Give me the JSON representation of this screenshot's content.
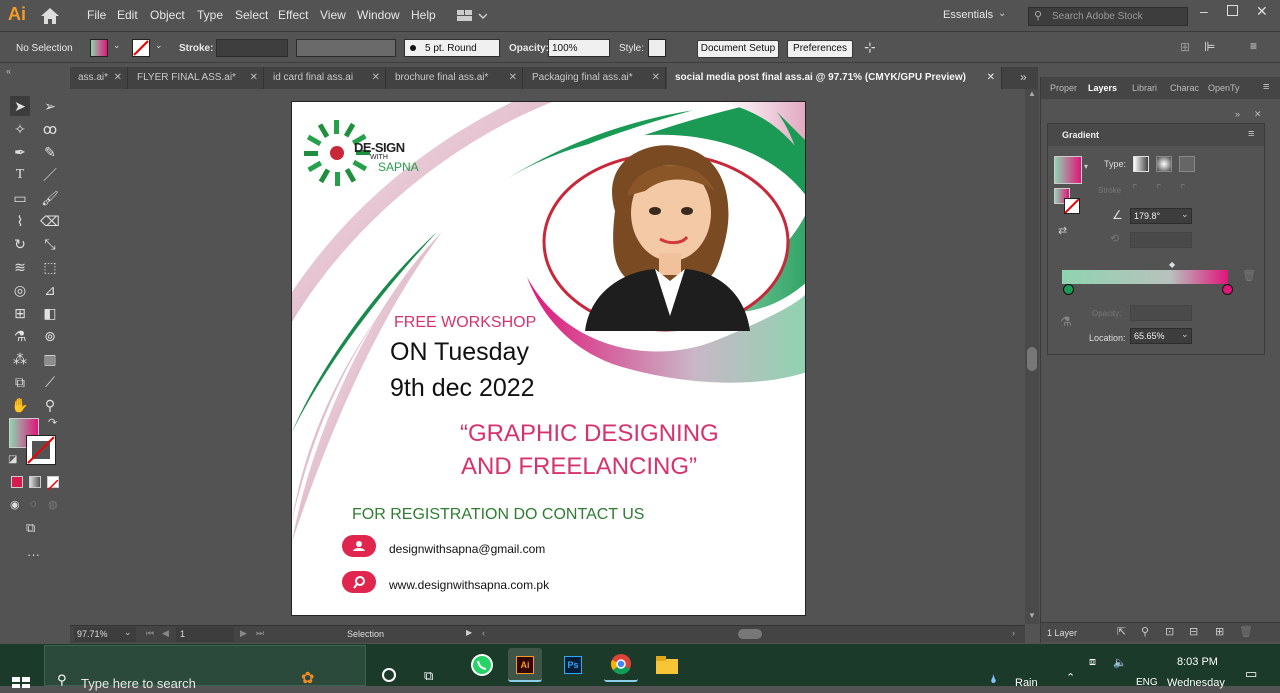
{
  "app": {
    "logo": "Ai",
    "workspace": "Essentials",
    "search_placeholder": "Search Adobe Stock"
  },
  "menu": [
    "File",
    "Edit",
    "Object",
    "Type",
    "Select",
    "Effect",
    "View",
    "Window",
    "Help"
  ],
  "control": {
    "selection": "No Selection",
    "stroke_label": "Stroke:",
    "brush": "5 pt. Round",
    "opacity_label": "Opacity:",
    "opacity_value": "100%",
    "style_label": "Style:",
    "doc_setup": "Document Setup",
    "preferences": "Preferences"
  },
  "tabs": [
    "ass.ai*",
    "FLYER FINAL ASS.ai*",
    "id card final ass.ai",
    "brochure final ass.ai*",
    "Packaging final ass.ai*",
    "social media post final ass.ai @ 97.71% (CMYK/GPU Preview)"
  ],
  "panel_tabs": [
    "Proper",
    "Layers",
    "Librari",
    "Charac",
    "OpenTy"
  ],
  "gradient": {
    "title": "Gradient",
    "type_label": "Type:",
    "stroke_label": "Stroke",
    "angle": "179.8°",
    "opacity_label": "Opacity:",
    "location_label": "Location:",
    "location_value": "65.65%"
  },
  "status": {
    "zoom": "97.71%",
    "artboard": "1",
    "mode": "Selection",
    "layers": "1 Layer"
  },
  "poster": {
    "logo_line1": "DE-SIGN",
    "logo_line2": "WITH",
    "logo_line3": "SAPNA",
    "workshop": "FREE WORKSHOP",
    "day": "ON Tuesday",
    "date": "9th dec 2022",
    "title1": "“GRAPHIC DESIGNING",
    "title2": "AND FREELANCING”",
    "register": "FOR REGISTRATION DO CONTACT US",
    "email": "designwithsapna@gmail.com",
    "website": "www.designwithsapna.com.pk"
  },
  "taskbar": {
    "search": "Type here to search",
    "weather": "Rain",
    "lang": "ENG",
    "time": "8:03 PM",
    "day": "Wednesday"
  },
  "colors": {
    "pink": "#d6336c",
    "green": "#2e8b57",
    "gradient_start": "#8fd3b0",
    "gradient_end": "#e0157a"
  }
}
